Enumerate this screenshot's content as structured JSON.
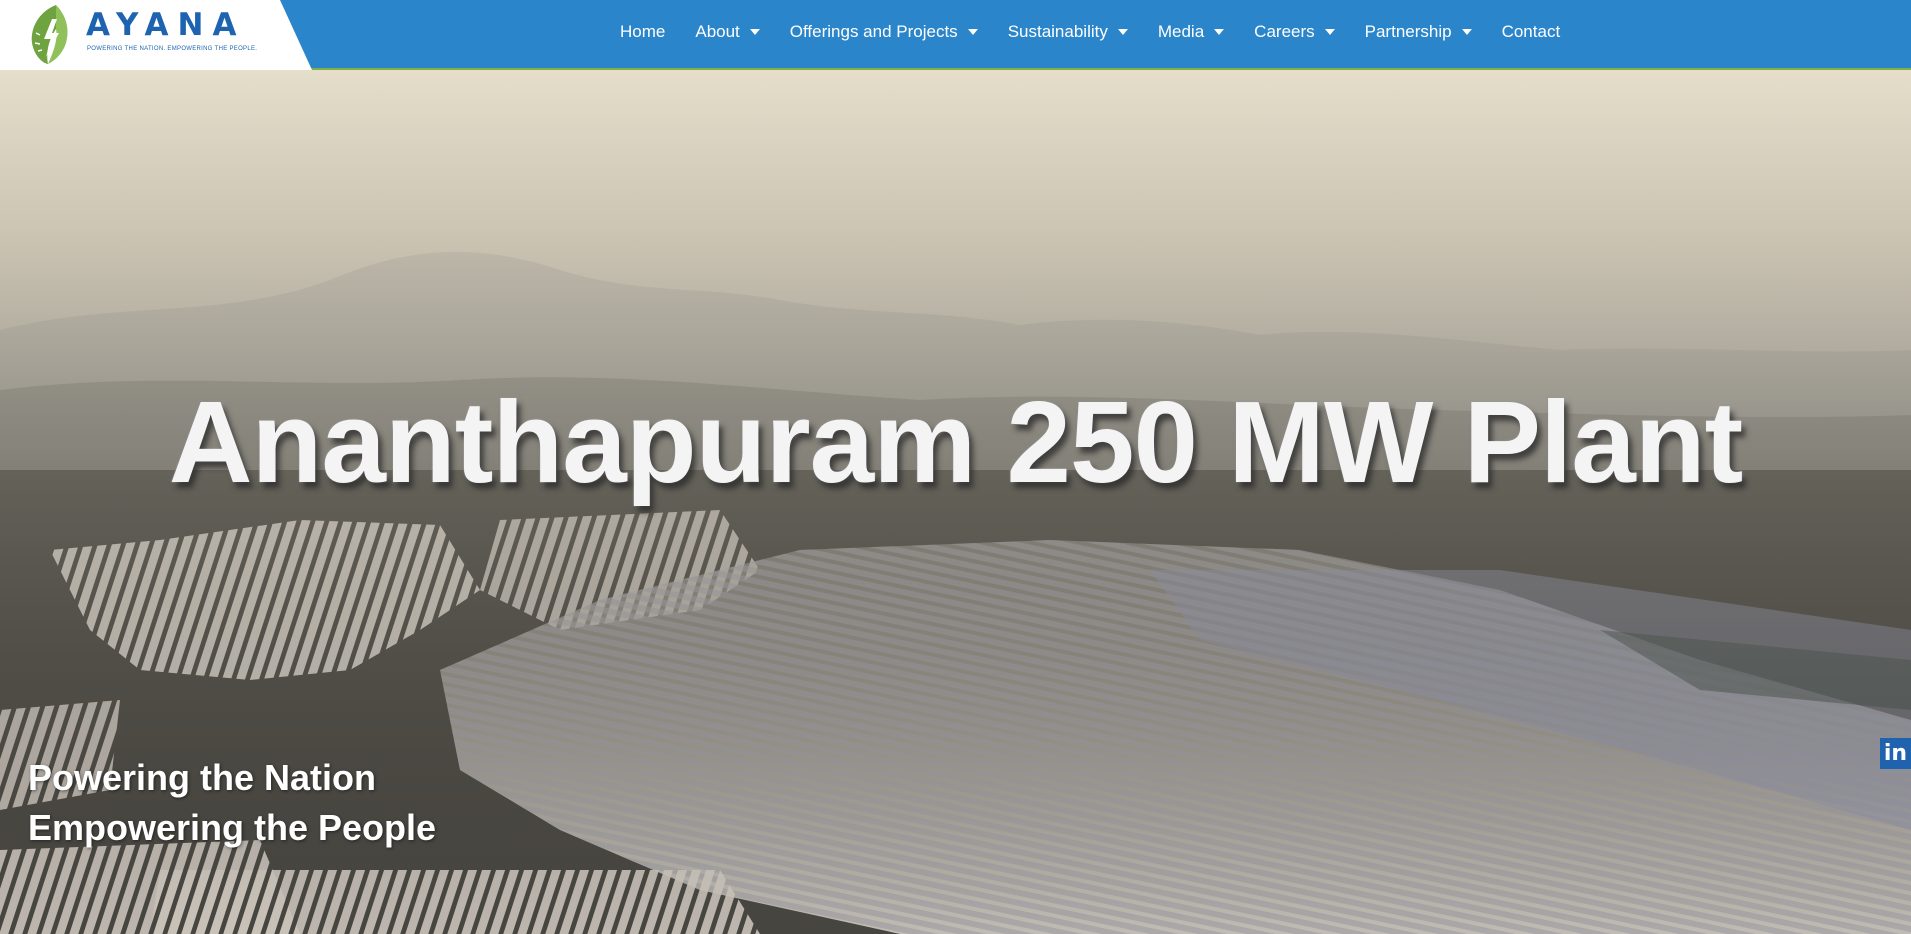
{
  "brand": {
    "name": "AYANA",
    "tagline": "POWERING THE NATION. EMPOWERING THE PEOPLE.",
    "color": "#1e63b0",
    "leaf_color": "#6ea33f"
  },
  "nav": {
    "items": [
      {
        "label": "Home",
        "dropdown": false
      },
      {
        "label": "About",
        "dropdown": true
      },
      {
        "label": "Offerings and Projects",
        "dropdown": true
      },
      {
        "label": "Sustainability",
        "dropdown": true
      },
      {
        "label": "Media",
        "dropdown": true
      },
      {
        "label": "Careers",
        "dropdown": true
      },
      {
        "label": "Partnership",
        "dropdown": true
      },
      {
        "label": "Contact",
        "dropdown": false
      }
    ],
    "background": "#2a85cb",
    "border": "#7fb148"
  },
  "hero": {
    "title": "Ananthapuram 250 MW Plant",
    "tagline_line1": "Powering the Nation",
    "tagline_line2": "Empowering the People"
  },
  "social": {
    "linkedin_icon": "linkedin-icon",
    "linkedin_text": "in",
    "color": "#1f63ae"
  }
}
